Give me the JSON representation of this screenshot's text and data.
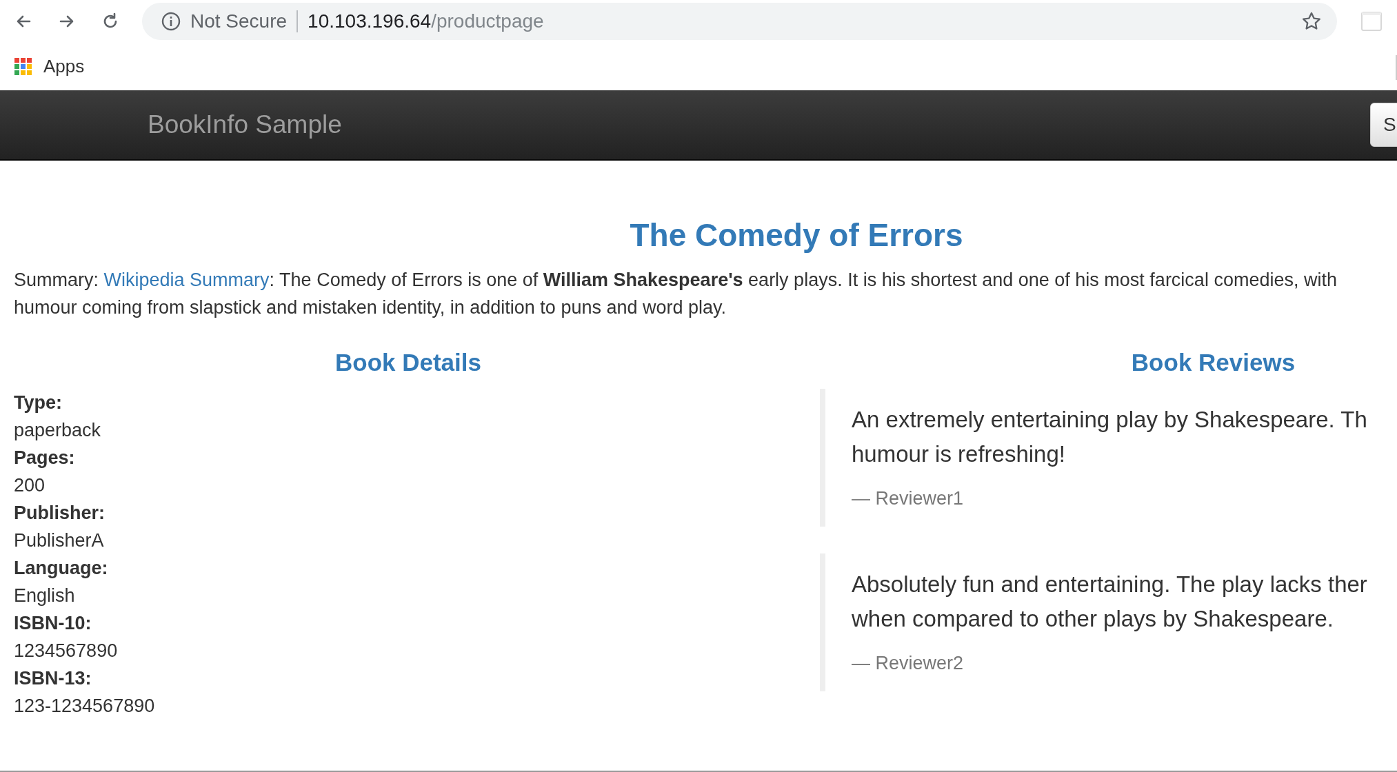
{
  "browser": {
    "security_label": "Not Secure",
    "url_host": "10.103.196.64",
    "url_path": "/productpage",
    "bookmarks": [
      {
        "label": "Apps"
      }
    ]
  },
  "navbar": {
    "brand": "BookInfo Sample",
    "button": "S"
  },
  "product": {
    "title": "The Comedy of Errors",
    "summary": {
      "label": "Summary: ",
      "link": "Wikipedia Summary",
      "lines": [
        ": The Comedy of Errors is one of **William Shakespeare's** early plays. It is his shortest and one of his most farcical comedies, with",
        "humour coming from slapstick and mistaken identity, in addition to puns and word play."
      ]
    }
  },
  "details": {
    "heading": "Book Details",
    "fields": [
      {
        "label": "Type:",
        "value": "paperback"
      },
      {
        "label": "Pages:",
        "value": "200"
      },
      {
        "label": "Publisher:",
        "value": "PublisherA"
      },
      {
        "label": "Language:",
        "value": "English"
      },
      {
        "label": "ISBN-10:",
        "value": "1234567890"
      },
      {
        "label": "ISBN-13:",
        "value": "123-1234567890"
      }
    ]
  },
  "reviews": {
    "heading": "Book Reviews",
    "items": [
      {
        "lines": [
          "An extremely entertaining play by Shakespeare. Th",
          "humour is refreshing!"
        ],
        "reviewer": "— Reviewer1"
      },
      {
        "lines": [
          "Absolutely fun and entertaining. The play lacks ther",
          "when compared to other plays by Shakespeare."
        ],
        "reviewer": "— Reviewer2"
      }
    ]
  }
}
